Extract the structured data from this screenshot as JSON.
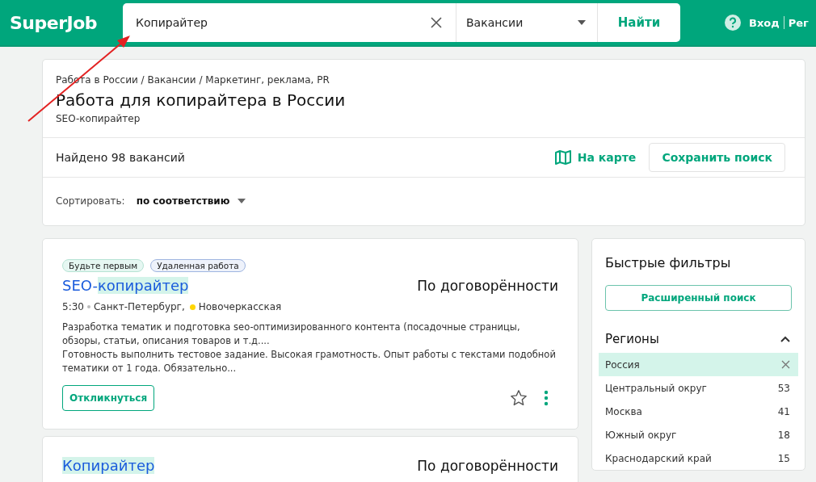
{
  "header": {
    "logo": "SuperJob",
    "search": {
      "value": "Копирайтер"
    },
    "category": {
      "value": "Вакансии"
    },
    "search_button": "Найти",
    "login": "Вход",
    "register": "Рег"
  },
  "annotation": {
    "kind": "arrow"
  },
  "summary": {
    "breadcrumbs": "Работа в России / Вакансии / Маркетинг, реклама, PR",
    "title": "Работа для копирайтера в России",
    "subtitle": "SEO-копирайтер",
    "found": "Найдено 98 вакансий",
    "map_link": "На карте",
    "save_button": "Сохранить поиск",
    "sort_label": "Сортировать:",
    "sort_value": "по соответствию"
  },
  "vacancies": [
    {
      "tags": [
        {
          "label": "Будьте первым",
          "kind": "green"
        },
        {
          "label": "Удаленная работа",
          "kind": "blue"
        }
      ],
      "title": [
        {
          "text": "SEO-",
          "highlight": false
        },
        {
          "text": "копирайтер",
          "highlight": true
        }
      ],
      "salary": "По договорённости",
      "time": "5:30",
      "city": "Санкт-Петербург,",
      "metro": {
        "name": "Новочеркасская",
        "color": "#ffd600"
      },
      "description": [
        "Разработка тематик и подготовка seo-оптимизированного контента (посадочные страницы, обзоры, статьи, описания товаров и т.д....",
        "Готовность выполнить тестовое задание. Высокая грамотность. Опыт работы с текстами подобной тематики от 1 года. Обязательно..."
      ],
      "respond_button": "Откликнуться",
      "favorite": false
    },
    {
      "title": [
        {
          "text": "Копирайтер",
          "highlight": true
        }
      ],
      "salary": "По договорённости"
    }
  ],
  "filters": {
    "title": "Быстрые фильтры",
    "advanced_button": "Расширенный поиск",
    "regions_title": "Регионы",
    "expanded": true,
    "regions": [
      {
        "name": "Россия",
        "selected": true
      },
      {
        "name": "Центральный округ",
        "count": "53",
        "selected": false
      },
      {
        "name": "Москва",
        "count": "41",
        "selected": false
      },
      {
        "name": "Южный округ",
        "count": "18",
        "selected": false
      },
      {
        "name": "Краснодарский край",
        "count": "15",
        "selected": false
      }
    ]
  }
}
